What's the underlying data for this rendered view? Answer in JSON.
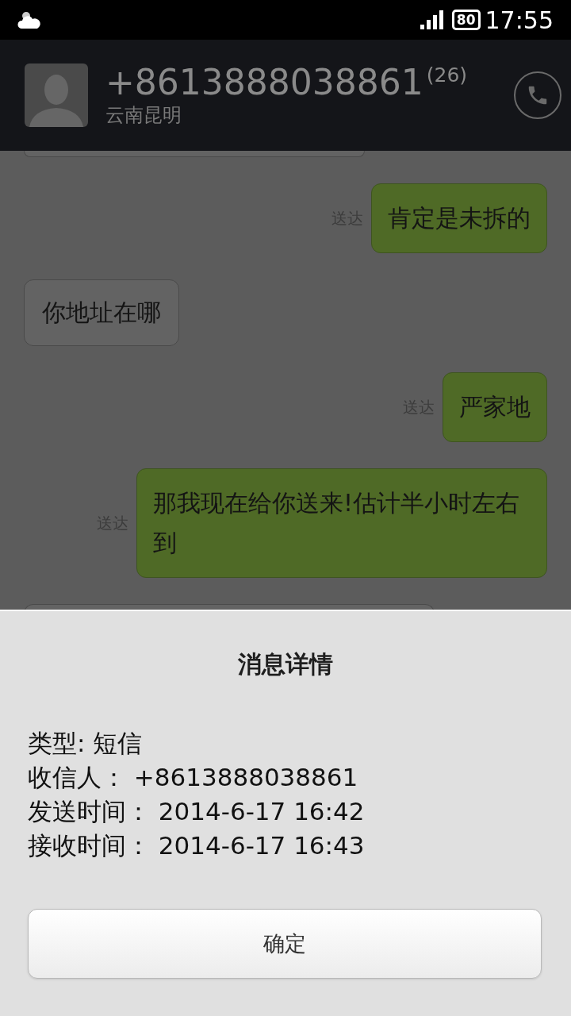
{
  "status_bar": {
    "battery": "80",
    "time": "17:55"
  },
  "contact": {
    "number": "+8613888038861",
    "count": "(26)",
    "location": "云南昆明"
  },
  "messages": [
    {
      "kind": "out",
      "text": "肯定是未拆的",
      "status": "送达"
    },
    {
      "kind": "in",
      "text": "你地址在哪"
    },
    {
      "kind": "out",
      "text": "严家地",
      "status": "送达"
    },
    {
      "kind": "out",
      "text": "那我现在给你送来!估计半小时左右到",
      "status": "送达"
    }
  ],
  "dialog": {
    "title": "消息详情",
    "details": [
      "类型: 短信",
      "收信人： +8613888038861",
      "发送时间： 2014-6-17 16:42",
      "接收时间： 2014-6-17 16:43"
    ],
    "button": "确定"
  }
}
